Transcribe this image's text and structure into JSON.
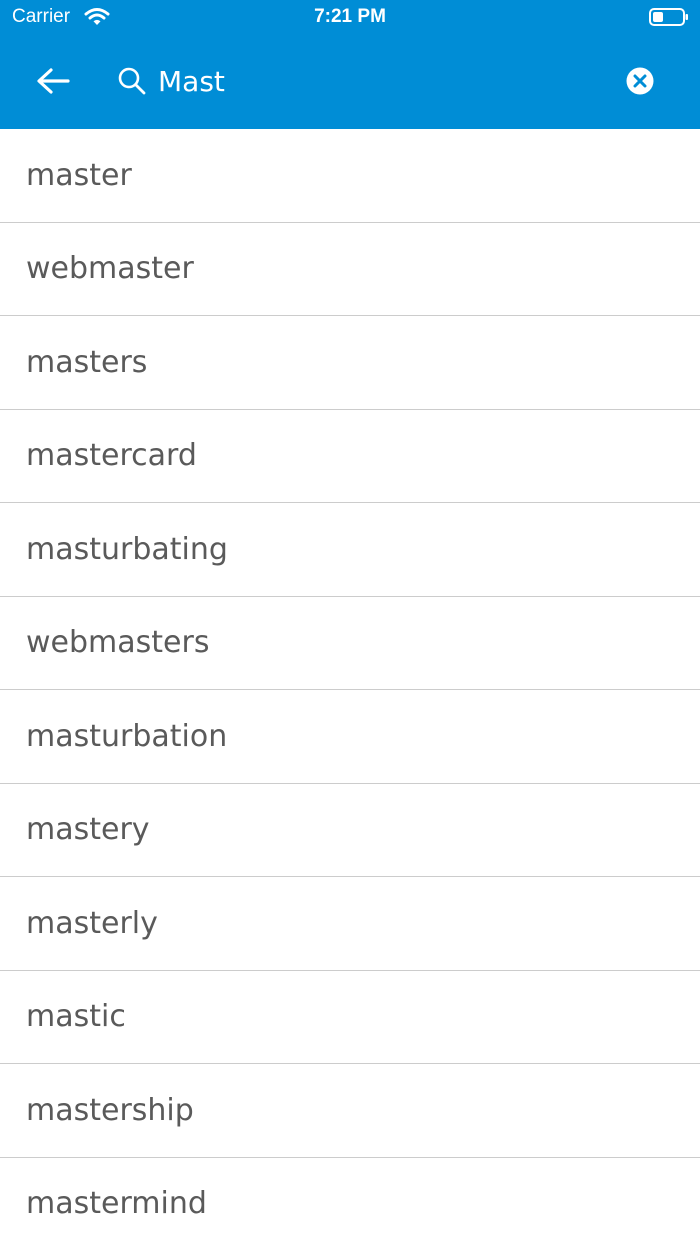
{
  "status_bar": {
    "carrier": "Carrier",
    "time": "7:21 PM",
    "wifi_icon": "wifi-icon",
    "battery_icon": "battery-icon"
  },
  "toolbar": {
    "back_icon": "arrow-left-icon",
    "search_icon": "search-icon",
    "clear_icon": "close-circle-icon",
    "search_value": "Mast"
  },
  "colors": {
    "header_bg": "#008dd6",
    "header_fg": "#ffffff",
    "row_text": "#5a5a5a",
    "divider": "#cccccc"
  },
  "results": [
    "master",
    "webmaster",
    "masters",
    "mastercard",
    "masturbating",
    "webmasters",
    "masturbation",
    "mastery",
    "masterly",
    "mastic",
    "mastership",
    "mastermind"
  ]
}
